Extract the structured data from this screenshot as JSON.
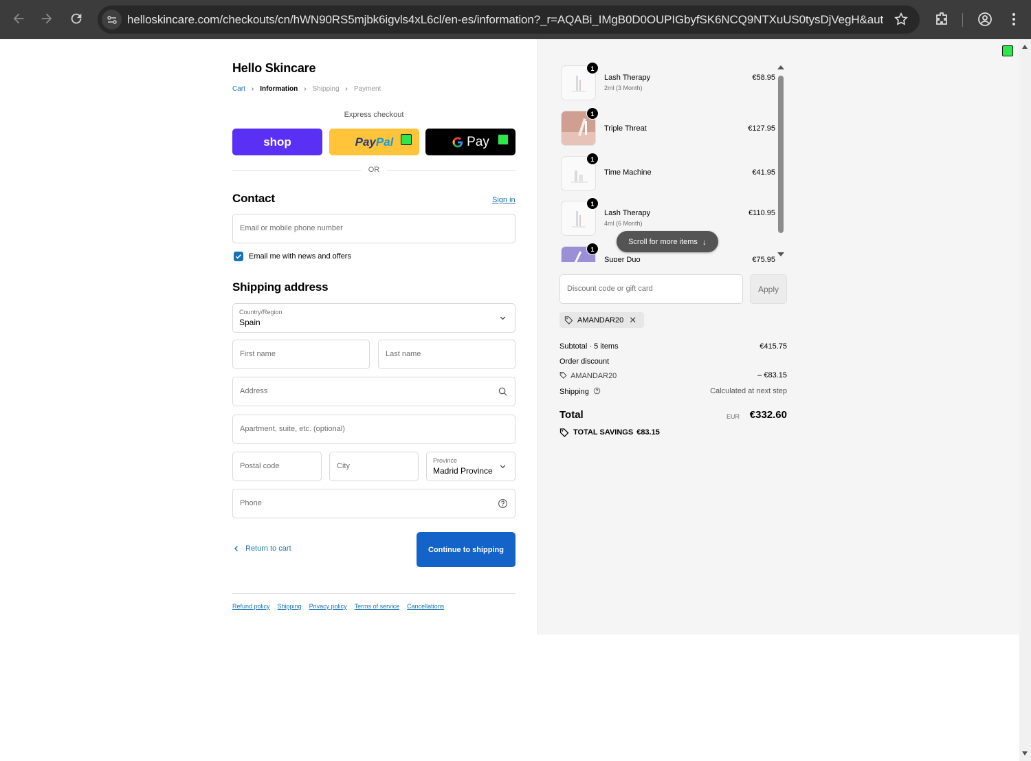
{
  "browser": {
    "url": "helloskincare.com/checkouts/cn/hWN90RS5mjbk6igvls4xL6cl/en-es/information?_r=AQABi_IMgB0D0OUPIGbyfSK6NCQ9NTXuUS0tysDjVegH&auto_re..."
  },
  "shop": {
    "name": "Hello Skincare"
  },
  "breadcrumb": [
    {
      "label": "Cart"
    },
    {
      "label": "Information"
    },
    {
      "label": "Shipping"
    },
    {
      "label": "Payment"
    }
  ],
  "express": {
    "label": "Express checkout",
    "shop_label": "shop",
    "paypal_part1": "Pay",
    "paypal_part2": "Pal",
    "gpay_label": "Pay",
    "or_label": "OR"
  },
  "contact": {
    "title": "Contact",
    "signin": "Sign in",
    "email_placeholder": "Email or mobile phone number",
    "newsletter_label": "Email me with news and offers",
    "newsletter_checked": true
  },
  "shipping": {
    "title": "Shipping address",
    "country_label": "Country/Region",
    "country_value": "Spain",
    "first_name": "First name",
    "last_name": "Last name",
    "address": "Address",
    "apartment": "Apartment, suite, etc. (optional)",
    "postal": "Postal code",
    "city": "City",
    "province_label": "Province",
    "province_value": "Madrid Province",
    "phone": "Phone"
  },
  "actions": {
    "return": "Return to cart",
    "continue": "Continue to shipping"
  },
  "footer": [
    "Refund policy",
    "Shipping",
    "Privacy policy",
    "Terms of service",
    "Cancellations"
  ],
  "order": {
    "items": [
      {
        "qty": "1",
        "name": "Lash Therapy",
        "variant": "2ml (3 Month)",
        "price": "€58.95"
      },
      {
        "qty": "1",
        "name": "Triple Threat",
        "variant": "",
        "price": "€127.95"
      },
      {
        "qty": "1",
        "name": "Time Machine",
        "variant": "",
        "price": "€41.95"
      },
      {
        "qty": "1",
        "name": "Lash Therapy",
        "variant": "4ml (6 Month)",
        "price": "€110.95"
      },
      {
        "qty": "1",
        "name": "Super Duo",
        "variant": "",
        "price": "€75.95"
      }
    ],
    "scroll_hint": "Scroll for more items",
    "discount_placeholder": "Discount code or gift card",
    "apply": "Apply",
    "applied_code": "AMANDAR20",
    "subtotal_label": "Subtotal · 5 items",
    "subtotal_value": "€415.75",
    "order_discount_label": "Order discount",
    "discount_code": "AMANDAR20",
    "discount_value": "– €83.15",
    "shipping_label": "Shipping",
    "shipping_value": "Calculated at next step",
    "total_label": "Total",
    "currency": "EUR",
    "total_value": "€332.60",
    "savings_label": "TOTAL SAVINGS",
    "savings_value": "€83.15"
  },
  "colors": {
    "shop_pay": "#5a31f4",
    "paypal": "#ffc439",
    "primary": "#1463c9",
    "link": "#1773b0"
  }
}
